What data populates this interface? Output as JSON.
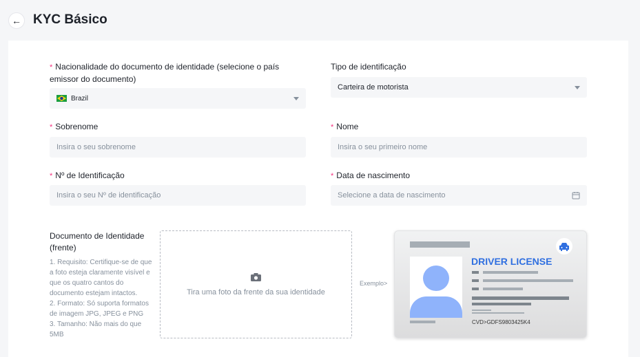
{
  "header": {
    "title": "KYC Básico"
  },
  "form": {
    "nationality": {
      "label": "Nacionalidade do documento de identidade (selecione o país emissor do documento)",
      "value": "Brazil"
    },
    "id_type": {
      "label": "Tipo de identificação",
      "value": "Carteira de motorista"
    },
    "surname": {
      "label": "Sobrenome",
      "placeholder": "Insira o seu sobrenome"
    },
    "name": {
      "label": "Nome",
      "placeholder": "Insira o seu primeiro nome"
    },
    "id_number": {
      "label": "Nº de Identificação",
      "placeholder": "Insira o seu Nº de identificação"
    },
    "birthdate": {
      "label": "Data de nascimento",
      "placeholder": "Selecione a data de nascimento"
    },
    "required_mark": "*"
  },
  "upload": {
    "label": "Documento de Identidade (frente)",
    "hints": [
      "1. Requisito: Certifique-se de que a foto esteja claramente visível e que os quatro cantos do documento estejam intactos.",
      "2. Formato: Só suporta formatos de imagem JPG, JPEG e PNG",
      "3. Tamanho: Não mais do que 5MB"
    ],
    "dropzone_text": "Tira uma foto da frente da sua identidade",
    "example_label": "Exemplo>",
    "example_card": {
      "title": "DRIVER LICENSE",
      "code": "CVD>GDFS9803425K4"
    }
  }
}
